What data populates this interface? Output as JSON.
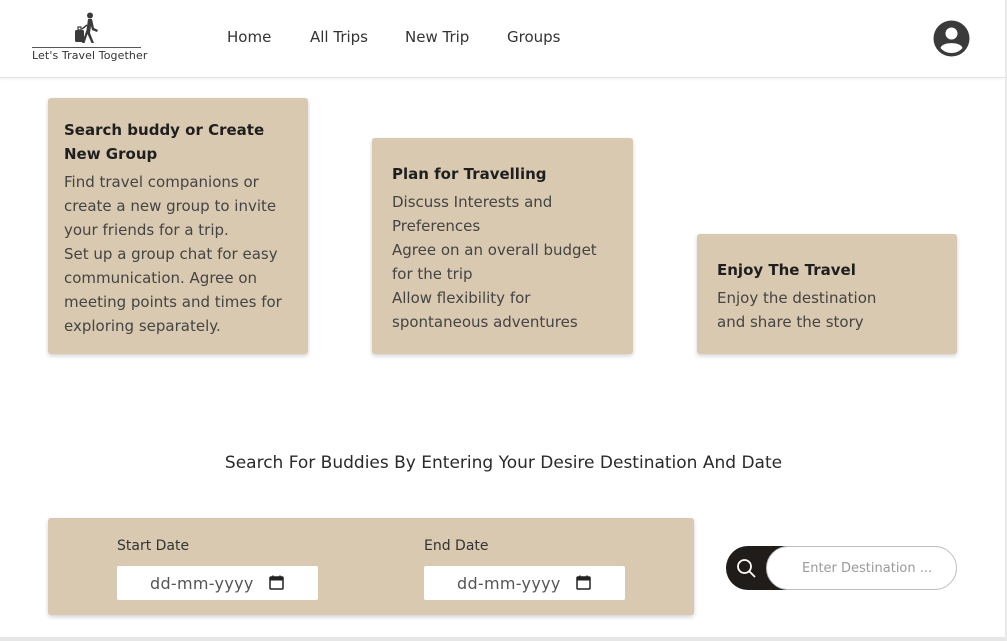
{
  "brand": {
    "tagline": "Let's Travel Together",
    "logo_icon": "traveler-with-suitcase-icon"
  },
  "nav": {
    "links": [
      "Home",
      "All Trips",
      "New Trip",
      "Groups"
    ],
    "profile_icon": "user-avatar-icon"
  },
  "cards": [
    {
      "title": "Search buddy or Create New Group",
      "body": [
        "Find travel companions or create a new group to invite your friends for a trip.",
        "Set up a group chat for easy communication. Agree on meeting points and times for exploring separately."
      ]
    },
    {
      "title": "Plan for Travelling",
      "body": [
        "Discuss Interests and Preferences",
        "Agree on an overall budget for the trip",
        "Allow flexibility for spontaneous adventures"
      ]
    },
    {
      "title": "Enjoy The Travel",
      "body": [
        "Enjoy the destination and share the story"
      ]
    }
  ],
  "search": {
    "heading": "Search For Buddies By Entering Your Desire Destination And Date",
    "start_label": "Start Date",
    "start_value": "dd-mm-yyyy",
    "end_label": "End Date",
    "end_value": "dd-mm-yyyy",
    "destination_placeholder": "Enter Destination ...",
    "search_icon": "search-icon"
  },
  "colors": {
    "card_bg": "#d9c9b0",
    "search_button": "#1f1c1a"
  }
}
